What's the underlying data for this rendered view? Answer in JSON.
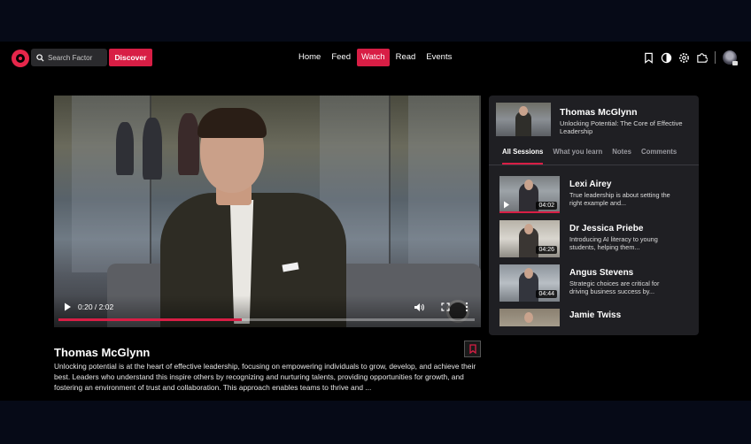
{
  "header": {
    "logo_icon": "target-logo-icon",
    "search_placeholder": "Search Factor",
    "discover_label": "Discover",
    "nav": [
      {
        "label": "Home",
        "active": false
      },
      {
        "label": "Feed",
        "active": false
      },
      {
        "label": "Watch",
        "active": true
      },
      {
        "label": "Read",
        "active": false
      },
      {
        "label": "Events",
        "active": false
      }
    ],
    "icons": [
      "bookmark-icon",
      "contrast-icon",
      "settings-icon",
      "puzzle-icon"
    ],
    "accent_color": "#d81e45"
  },
  "video": {
    "time": "0:20 / 2:02",
    "progress": 0.44,
    "title": "Thomas McGlynn",
    "description": "Unlocking potential is at the heart of effective leadership, focusing on empowering individuals to grow, develop, and achieve their best. Leaders who understand this inspire others by recognizing and nurturing talents, providing opportunities for growth, and fostering an environment of trust and collaboration. This approach enables teams to thrive and ..."
  },
  "panel": {
    "now_playing": {
      "name": "Thomas McGlynn",
      "subtitle": "Unlocking Potential: The Core of Effective Leadership"
    },
    "tabs": [
      {
        "label": "All Sessions",
        "active": true
      },
      {
        "label": "What you learn",
        "active": false
      },
      {
        "label": "Notes",
        "active": false
      },
      {
        "label": "Comments",
        "active": false
      }
    ],
    "sessions": [
      {
        "name": "Lexi Airey",
        "text": "True leadership is about setting the right example and...",
        "duration": "04:02"
      },
      {
        "name": "Dr Jessica Priebe",
        "text": "Introducing AI literacy to young students, helping them...",
        "duration": "04:26"
      },
      {
        "name": "Angus Stevens",
        "text": "Strategic choices are critical for driving business success by...",
        "duration": "04:44"
      },
      {
        "name": "Jamie Twiss",
        "text": "",
        "duration": ""
      }
    ]
  }
}
